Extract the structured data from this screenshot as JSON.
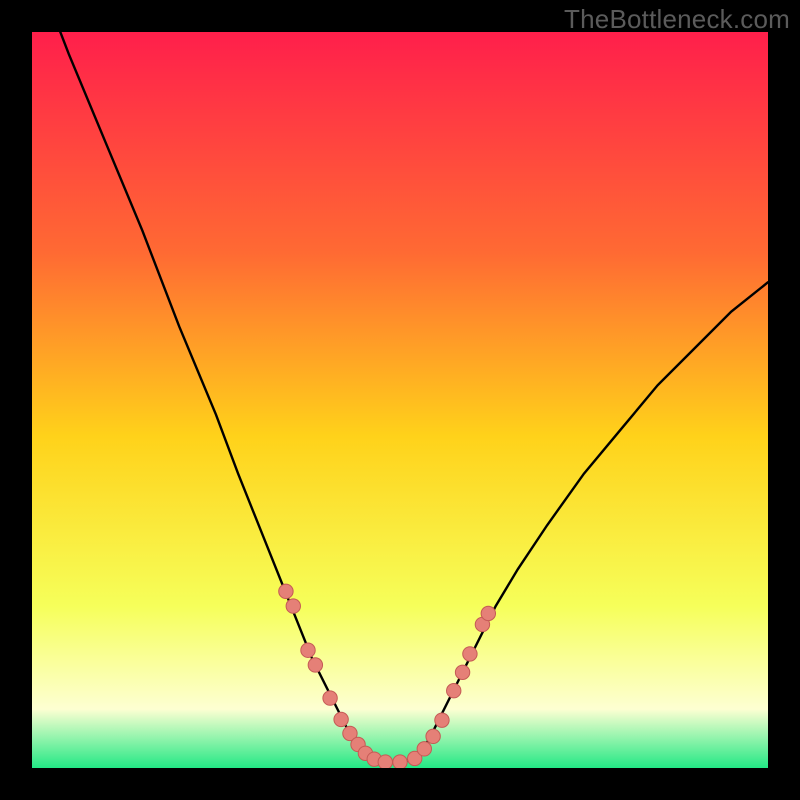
{
  "watermark": "TheBottleneck.com",
  "colors": {
    "frame": "#000000",
    "gradient_top": "#ff1f4b",
    "gradient_mid_upper": "#ff6a33",
    "gradient_mid": "#ffd21a",
    "gradient_lower": "#f6ff5a",
    "gradient_pale": "#fdffd2",
    "gradient_green": "#23e885",
    "curve": "#000000",
    "marker_fill": "#e58077",
    "marker_stroke": "#c55a55"
  },
  "chart_data": {
    "type": "line",
    "title": "",
    "xlabel": "",
    "ylabel": "",
    "xlim": [
      0,
      100
    ],
    "ylim": [
      0,
      100
    ],
    "grid": false,
    "series": [
      {
        "name": "bottleneck-curve",
        "x": [
          0,
          5,
          10,
          15,
          20,
          25,
          28,
          30,
          32,
          34,
          36,
          38,
          40,
          41,
          42,
          43,
          44,
          45,
          46,
          47,
          48,
          49,
          50,
          51,
          52,
          53,
          54,
          55,
          57,
          60,
          63,
          66,
          70,
          75,
          80,
          85,
          90,
          95,
          100
        ],
        "y": [
          110,
          97,
          85,
          73,
          60,
          48,
          40,
          35,
          30,
          25,
          20,
          15,
          11,
          9,
          7,
          5,
          3.5,
          2.3,
          1.5,
          1.0,
          0.8,
          0.8,
          0.8,
          1.0,
          1.5,
          2.5,
          4,
          6,
          10,
          16,
          22,
          27,
          33,
          40,
          46,
          52,
          57,
          62,
          66
        ]
      }
    ],
    "markers": {
      "name": "sample-points",
      "x": [
        34.5,
        35.5,
        37.5,
        38.5,
        40.5,
        42.0,
        43.2,
        44.3,
        45.3,
        46.5,
        48.0,
        50.0,
        52.0,
        53.3,
        54.5,
        55.7,
        57.3,
        58.5,
        59.5,
        61.2,
        62.0
      ],
      "y": [
        24.0,
        22.0,
        16.0,
        14.0,
        9.5,
        6.6,
        4.7,
        3.2,
        2.0,
        1.2,
        0.8,
        0.8,
        1.3,
        2.6,
        4.3,
        6.5,
        10.5,
        13.0,
        15.5,
        19.5,
        21.0
      ]
    },
    "annotations": []
  }
}
